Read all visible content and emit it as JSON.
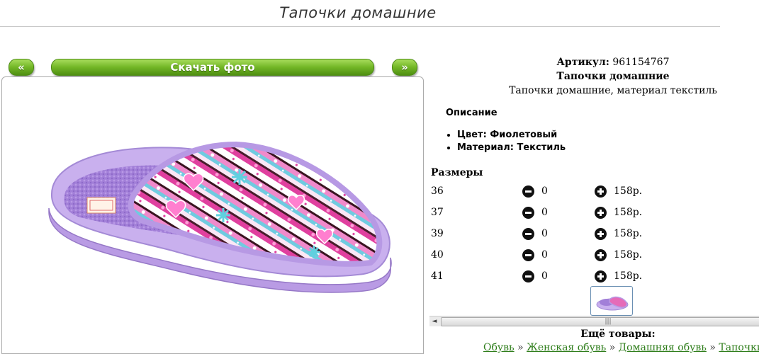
{
  "page": {
    "title": "Тапочки домашние"
  },
  "gallery": {
    "prev_label": "«",
    "download_label": "Скачать фото",
    "next_label": "»"
  },
  "product": {
    "article_label": "Артикул:",
    "article_value": "961154767",
    "name": "Тапочки домашние",
    "short_desc": "Тапочки домашние, материал текстиль",
    "desc_heading": "Описание",
    "props": [
      "Цвет: Фиолетовый",
      "Материал: Текстиль"
    ]
  },
  "sizes": {
    "heading": "Размеры",
    "rows": [
      {
        "size": "36",
        "qty": "0",
        "price": "158р."
      },
      {
        "size": "37",
        "qty": "0",
        "price": "158р."
      },
      {
        "size": "39",
        "qty": "0",
        "price": "158р."
      },
      {
        "size": "40",
        "qty": "0",
        "price": "158р."
      },
      {
        "size": "41",
        "qty": "0",
        "price": "158р."
      }
    ]
  },
  "scrollbar": {
    "left_arrow": "◄",
    "grip": "|||"
  },
  "more": {
    "heading": "Ещё товары:"
  },
  "breadcrumbs": [
    "Обувь",
    "Женская обувь",
    "Домашняя обувь",
    "Тапочки"
  ],
  "breadcrumb_sep": "»",
  "colors": {
    "button_green": "#72b626",
    "link_green": "#2e7d1a",
    "slipper_lilac": "#b39ae0",
    "pattern_pink": "#e56bb8"
  }
}
